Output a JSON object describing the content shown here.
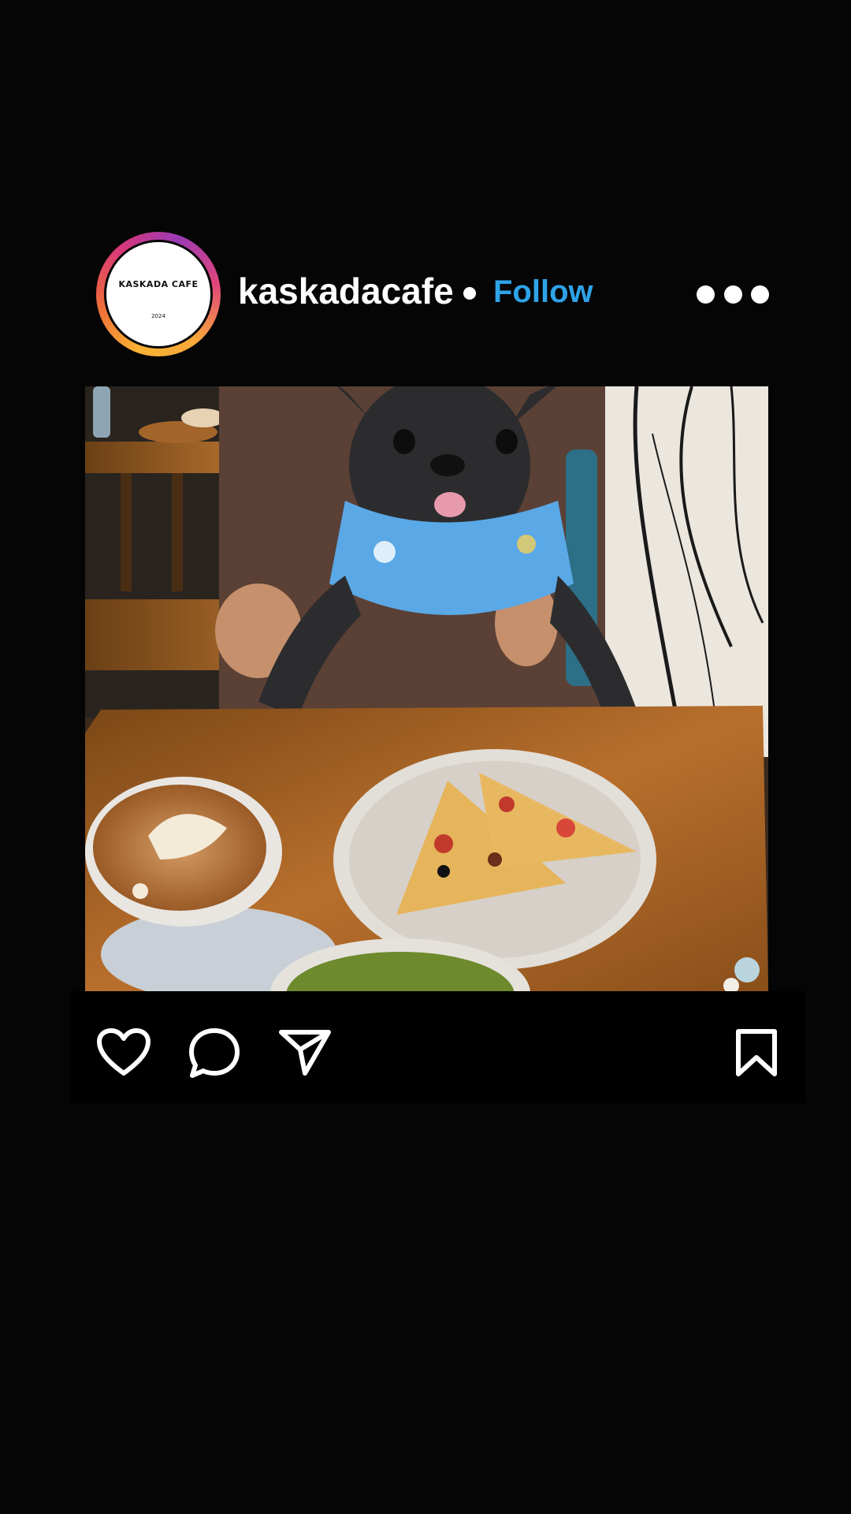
{
  "post": {
    "username": "kaskadacafe",
    "separator": "•",
    "follow_label": "Follow",
    "avatar": {
      "title": "KASKADA CAFE",
      "year": "2024"
    },
    "photo_alt": "kaskadacafe post photo"
  },
  "icons": {
    "more": "more-options-icon",
    "like": "heart-icon",
    "comment": "comment-icon",
    "share": "send-icon",
    "save": "bookmark-icon"
  },
  "colors": {
    "background": "#050505",
    "follow": "#2ea3e8",
    "text": "#ffffff"
  }
}
